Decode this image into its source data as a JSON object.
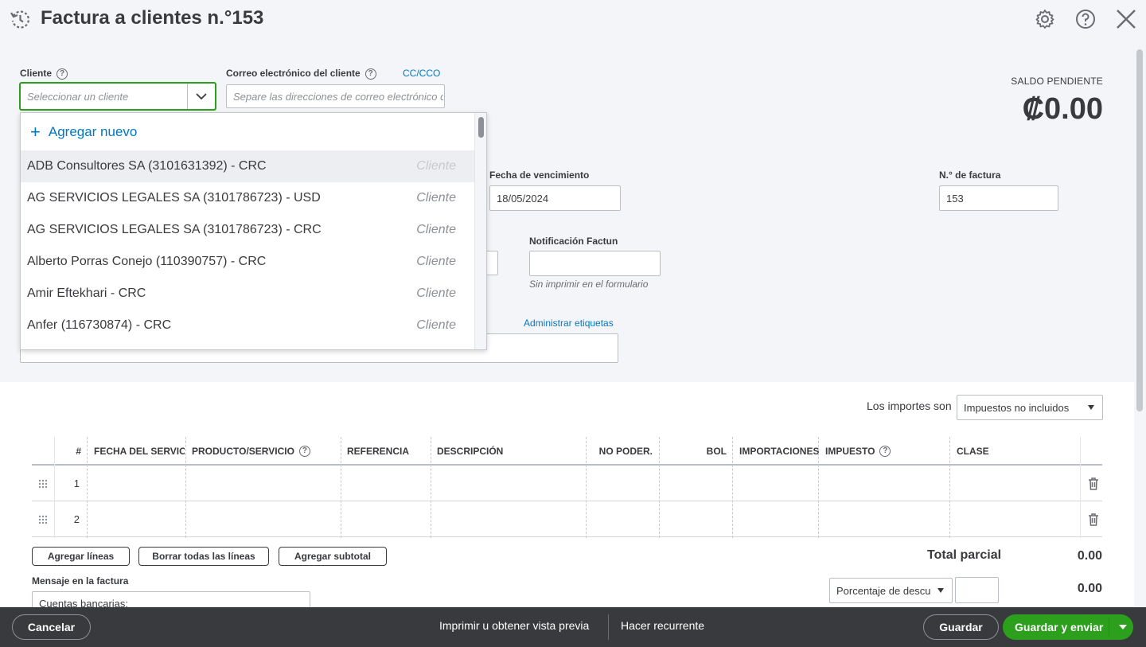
{
  "header": {
    "title": "Factura a clientes n.°153"
  },
  "customer": {
    "label": "Cliente",
    "placeholder": "Seleccionar un cliente"
  },
  "email": {
    "label": "Correo electrónico del cliente",
    "placeholder": "Separe las direcciones de correo electrónico con una coma",
    "cc_link": "CC/CCO"
  },
  "balance": {
    "label": "SALDO PENDIENTE",
    "amount": "₡0.00"
  },
  "dropdown": {
    "add_new": "Agregar nuevo",
    "items": [
      {
        "name": "ADB Consultores SA (3101631392)  - CRC",
        "type": "Cliente"
      },
      {
        "name": "AG SERVICIOS LEGALES SA (3101786723)  - USD",
        "type": "Cliente"
      },
      {
        "name": "AG SERVICIOS LEGALES SA (3101786723)  - CRC",
        "type": "Cliente"
      },
      {
        "name": "Alberto Porras Conejo (110390757)  - CRC",
        "type": "Cliente"
      },
      {
        "name": "Amir Eftekhari  - CRC",
        "type": "Cliente"
      },
      {
        "name": "Anfer (116730874)  - CRC",
        "type": "Cliente"
      }
    ]
  },
  "due_date": {
    "label": "Fecha de vencimiento",
    "value": "18/05/2024"
  },
  "invoice_no": {
    "label": "N.° de factura",
    "value": "153"
  },
  "notification": {
    "label": "Notificación Factun",
    "hint": "Sin imprimir en el formulario"
  },
  "tags": {
    "manage_link": "Administrar etiquetas"
  },
  "amounts": {
    "label": "Los importes son",
    "value": "Impuestos no incluidos"
  },
  "table": {
    "headers": {
      "num": "#",
      "service_date": "FECHA DEL SERVICIO",
      "product": "PRODUCTO/SERVICIO",
      "reference": "REFERENCIA",
      "description": "DESCRIPCIÓN",
      "no_poder": "NO PODER.",
      "bol": "BOL",
      "imports": "IMPORTACIONES",
      "tax": "IMPUESTO",
      "class": "CLASE"
    },
    "rows": [
      {
        "num": "1"
      },
      {
        "num": "2"
      }
    ]
  },
  "buttons": {
    "add_lines": "Agregar líneas",
    "clear_lines": "Borrar todas las líneas",
    "add_subtotal": "Agregar subtotal"
  },
  "subtotal": {
    "label": "Total parcial",
    "value": "0.00"
  },
  "discount": {
    "select": "Porcentaje de descuento",
    "value": "0.00"
  },
  "message": {
    "label": "Mensaje en la factura",
    "value": "Cuentas bancarias:"
  },
  "footer": {
    "cancel": "Cancelar",
    "print": "Imprimir u obtener vista previa",
    "recurring": "Hacer recurrente",
    "save": "Guardar",
    "save_send": "Guardar y enviar"
  }
}
